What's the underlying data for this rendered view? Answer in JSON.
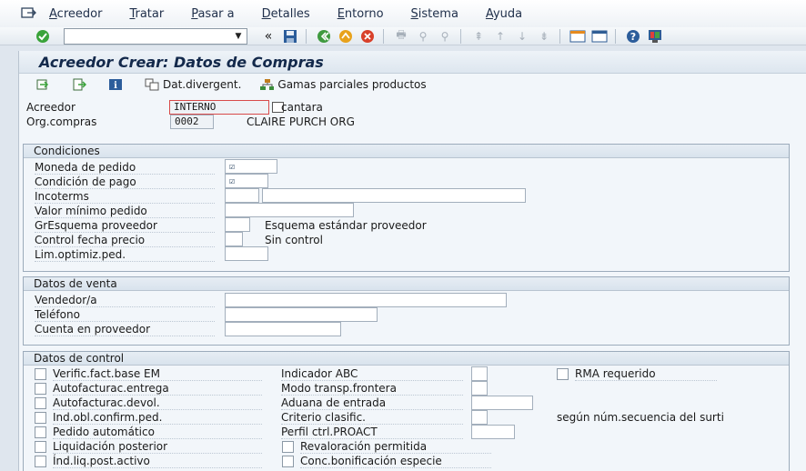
{
  "menu": [
    "Acreedor",
    "Tratar",
    "Pasar a",
    "Detalles",
    "Entorno",
    "Sistema",
    "Ayuda"
  ],
  "toolbar": {
    "back_glyph": "«"
  },
  "title": "Acreedor Crear: Datos de Compras",
  "app_toolbar": {
    "dat_divergent": "Dat.divergent.",
    "gamas": "Gamas parciales productos"
  },
  "header": {
    "acreedor_label": "Acreedor",
    "acreedor_value": "INTERNO",
    "acreedor_name": "cantara",
    "org_label": "Org.compras",
    "org_value": "0002",
    "org_name": "CLAIRE PURCH ORG"
  },
  "condiciones": {
    "title": "Condiciones",
    "moneda": "Moneda de pedido",
    "condicion_pago": "Condición de pago",
    "incoterms": "Incoterms",
    "valor_minimo": "Valor mínimo pedido",
    "gresquema": "GrEsquema proveedor",
    "gresquema_text": "Esquema estándar proveedor",
    "control_fecha": "Control fecha precio",
    "control_fecha_text": "Sin control",
    "lim_optimiz": "Lim.optimiz.ped."
  },
  "venta": {
    "title": "Datos de venta",
    "vendedor": "Vendedor/a",
    "telefono": "Teléfono",
    "cuenta": "Cuenta en proveedor"
  },
  "control": {
    "title": "Datos de control",
    "verific": "Verific.fact.base EM",
    "autofact_entrega": "Autofacturac.entrega",
    "autofact_devol": "Autofacturac.devol.",
    "ind_obl": "Ind.obl.confirm.ped.",
    "pedido_auto": "Pedido automático",
    "liquidacion": "Liquidación posterior",
    "ind_liq": "Índ.liq.post.activo",
    "indicador_abc": "Indicador ABC",
    "modo_transp": "Modo transp.frontera",
    "aduana": "Aduana de entrada",
    "criterio": "Criterio clasific.",
    "criterio_text": "según núm.secuencia del surti",
    "perfil": "Perfil ctrl.PROACT",
    "revaloracion": "Revaloración permitida",
    "conc_bonif": "Conc.bonificación especie",
    "rma": "RMA requerido"
  }
}
